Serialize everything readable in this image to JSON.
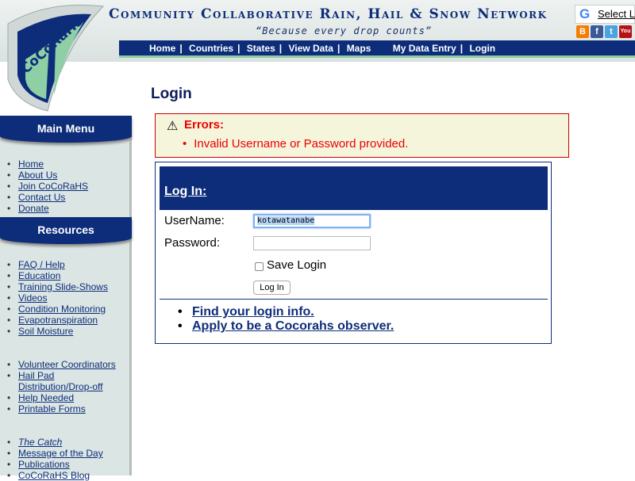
{
  "header": {
    "title": "Community Collaborative Rain, Hail & Snow Network",
    "tagline": "“Because every drop counts”",
    "logo_text": "CoCoRaHS",
    "nav": [
      "Home",
      "Countries",
      "States",
      "View Data",
      "Maps"
    ],
    "nav2": [
      "My Data Entry",
      "Login"
    ],
    "translate": "Select L",
    "social": [
      "blogger-icon",
      "facebook-icon",
      "twitter-icon",
      "youtube-icon"
    ]
  },
  "sidebar": {
    "main_menu_title": "Main Menu",
    "main_menu": [
      "Home",
      "About Us",
      "Join CoCoRaHS",
      "Contact Us",
      "Donate"
    ],
    "resources_title": "Resources",
    "resources": [
      "FAQ / Help",
      "Education",
      "Training Slide-Shows",
      "Videos",
      "Condition Monitoring",
      "Evapotranspiration",
      "Soil Moisture"
    ],
    "resources2": [
      "Volunteer Coordinators",
      "Hail Pad Distribution/Drop-off",
      "Help Needed",
      "Printable Forms"
    ],
    "resources3": [
      "The Catch",
      "Message of the Day",
      "Publications",
      "CoCoRaHS Blog"
    ]
  },
  "page": {
    "title": "Login",
    "errors_title": "Errors:",
    "error_msg": "Invalid Username or Password provided.",
    "login_header": "Log In:",
    "username_label": "UserName:",
    "username_value": "kotawatanabe",
    "password_label": "Password:",
    "save_login": "Save Login",
    "login_button": "Log In",
    "links": [
      "Find your login info.",
      "Apply to be a Cocorahs observer."
    ]
  }
}
